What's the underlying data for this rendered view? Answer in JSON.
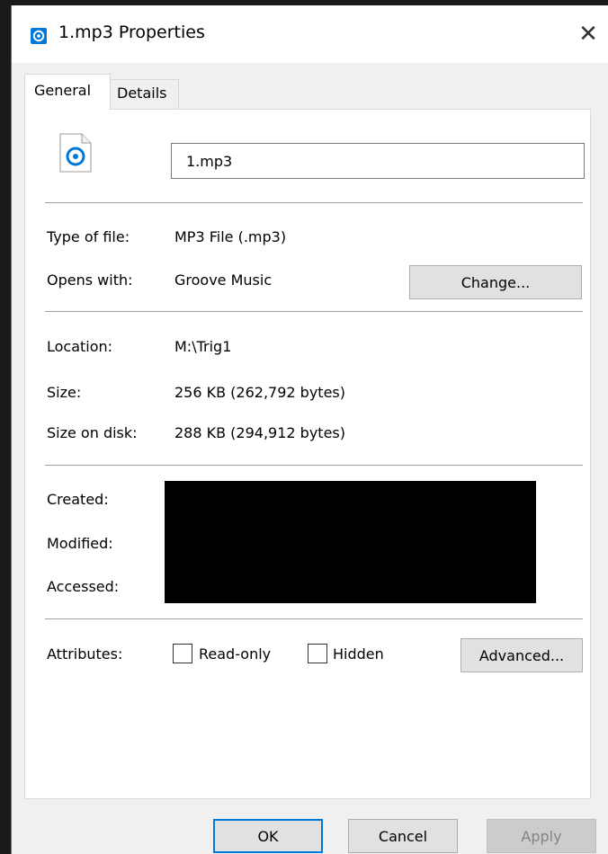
{
  "window": {
    "title": "1.mp3 Properties",
    "close_glyph": "✕"
  },
  "tabs": [
    {
      "label": "General",
      "active": true
    },
    {
      "label": "Details",
      "active": false
    }
  ],
  "general": {
    "filename": "1.mp3",
    "type_label": "Type of file:",
    "type_value": "MP3 File (.mp3)",
    "opens_label": "Opens with:",
    "opens_value": "Groove Music",
    "change_label": "Change...",
    "location_label": "Location:",
    "location_value": "M:\\Trig1",
    "size_label": "Size:",
    "size_value": "256 KB (262,792 bytes)",
    "size_disk_label": "Size on disk:",
    "size_disk_value": "288 KB (294,912 bytes)",
    "created_label": "Created:",
    "modified_label": "Modified:",
    "accessed_label": "Accessed:",
    "attributes_label": "Attributes:",
    "readonly_label": "Read-only",
    "readonly_checked": false,
    "hidden_label": "Hidden",
    "hidden_checked": false,
    "advanced_label": "Advanced..."
  },
  "footer": {
    "ok_label": "OK",
    "cancel_label": "Cancel",
    "apply_label": "Apply"
  },
  "colors": {
    "accent": "#0078d7",
    "icon_blue": "#0078d7"
  }
}
